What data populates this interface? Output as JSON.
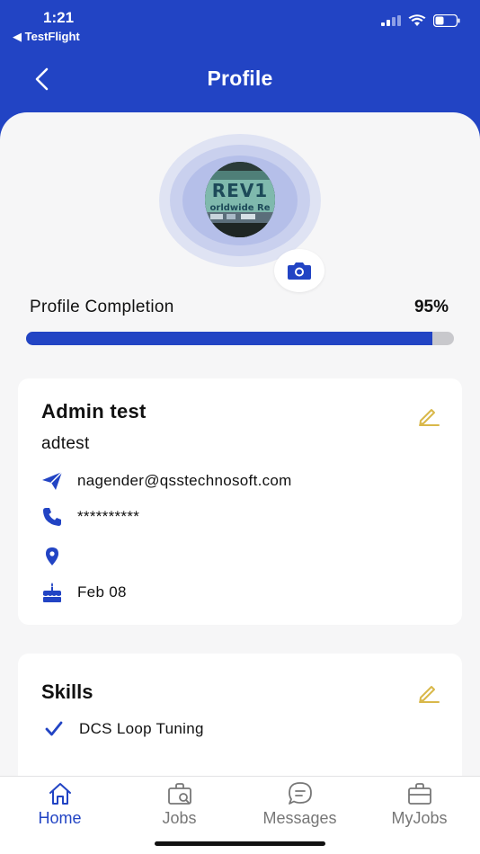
{
  "status_bar": {
    "time": "1:21",
    "back_app": "◀ TestFlight"
  },
  "header": {
    "title": "Profile"
  },
  "avatar": {
    "photo_text_line1": "REV1",
    "photo_text_line2": "orldwide Re"
  },
  "completion": {
    "label": "Profile Completion",
    "value_text": "95%",
    "percent": 95
  },
  "profile_card": {
    "name": "Admin test",
    "username": "adtest",
    "email": "nagender@qsstechnosoft.com",
    "phone": "**********",
    "location": "",
    "birthday": "Feb 08"
  },
  "skills_card": {
    "title": "Skills",
    "skills": [
      "DCS Loop Tuning"
    ]
  },
  "tabs": [
    {
      "label": "Home",
      "icon": "home-icon",
      "active": true
    },
    {
      "label": "Jobs",
      "icon": "jobs-icon",
      "active": false
    },
    {
      "label": "Messages",
      "icon": "messages-icon",
      "active": false
    },
    {
      "label": "MyJobs",
      "icon": "myjobs-icon",
      "active": false
    }
  ],
  "colors": {
    "primary": "#2244c4",
    "edit_accent": "#d9b84a",
    "background": "#f6f6f7"
  }
}
